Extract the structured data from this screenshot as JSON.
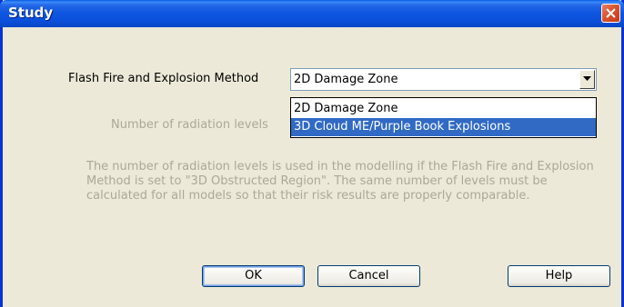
{
  "window": {
    "title": "Study",
    "close_icon": "close-icon"
  },
  "form": {
    "method_label": "Flash Fire and Explosion Method",
    "method_value": "2D Damage Zone",
    "method_options": [
      {
        "label": "2D Damage Zone",
        "selected": false
      },
      {
        "label": "3D Cloud ME/Purple Book Explosions",
        "selected": true
      }
    ],
    "radiation_label": "Number of radiation levels",
    "description": "The number of radiation levels is used in the modelling if the Flash Fire and Explosion Method is set to \"3D Obstructed Region\". The same number of levels must be calculated for all models so that their risk results are properly comparable."
  },
  "buttons": {
    "ok": "OK",
    "cancel": "Cancel",
    "help": "Help"
  },
  "colors": {
    "title_bar": "#0A4FD9",
    "selection": "#316AC5",
    "disabled_text": "#ACA899",
    "dialog_bg": "#ECE9D8"
  }
}
